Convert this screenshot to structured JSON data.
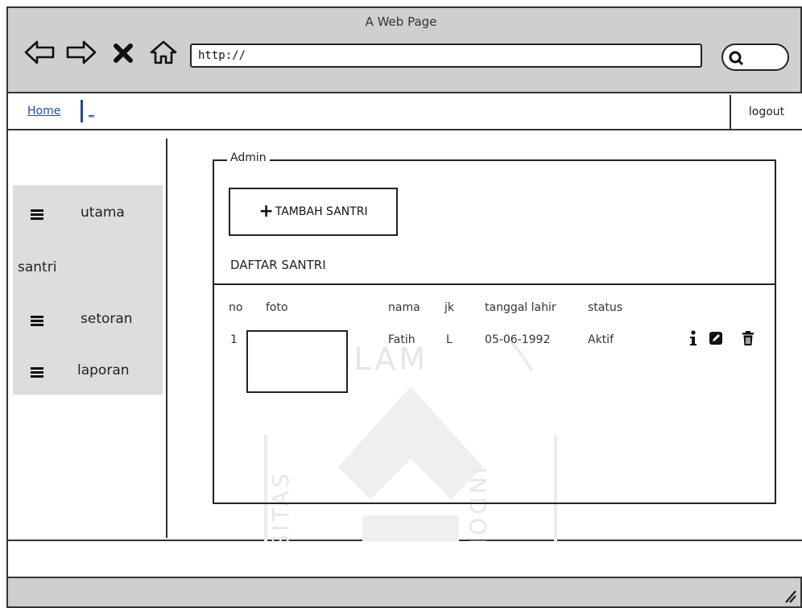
{
  "window": {
    "title": "A Web Page"
  },
  "toolbar": {
    "icons": [
      "back-arrow-icon",
      "forward-arrow-icon",
      "close-x-icon",
      "home-icon",
      "search-icon"
    ],
    "url": "http://"
  },
  "linkbar": {
    "home": "Home",
    "more": "_",
    "logout": "logout"
  },
  "sidebar": {
    "items": [
      {
        "label": "utama",
        "icon": "menu-icon"
      },
      {
        "label": "santri",
        "icon": ""
      },
      {
        "label": "setoran",
        "icon": "menu-icon"
      },
      {
        "label": "laporan",
        "icon": "menu-icon"
      }
    ]
  },
  "panel": {
    "legend": "Admin",
    "add_button": "TAMBAH SANTRI",
    "list_title": "DAFTAR SANTRI",
    "columns": [
      "no",
      "foto",
      "nama",
      "jk",
      "tanggal lahir",
      "status"
    ],
    "rows": [
      {
        "no": "1",
        "nama": "Fatih",
        "jk": "L",
        "tanggal_lahir": "05-06-1992",
        "status": "Aktif",
        "actions": [
          "info-icon",
          "edit-icon",
          "delete-icon"
        ]
      }
    ]
  },
  "watermark": {
    "text": [
      "ISLAM",
      "INDONES",
      "VERSITAS"
    ]
  }
}
